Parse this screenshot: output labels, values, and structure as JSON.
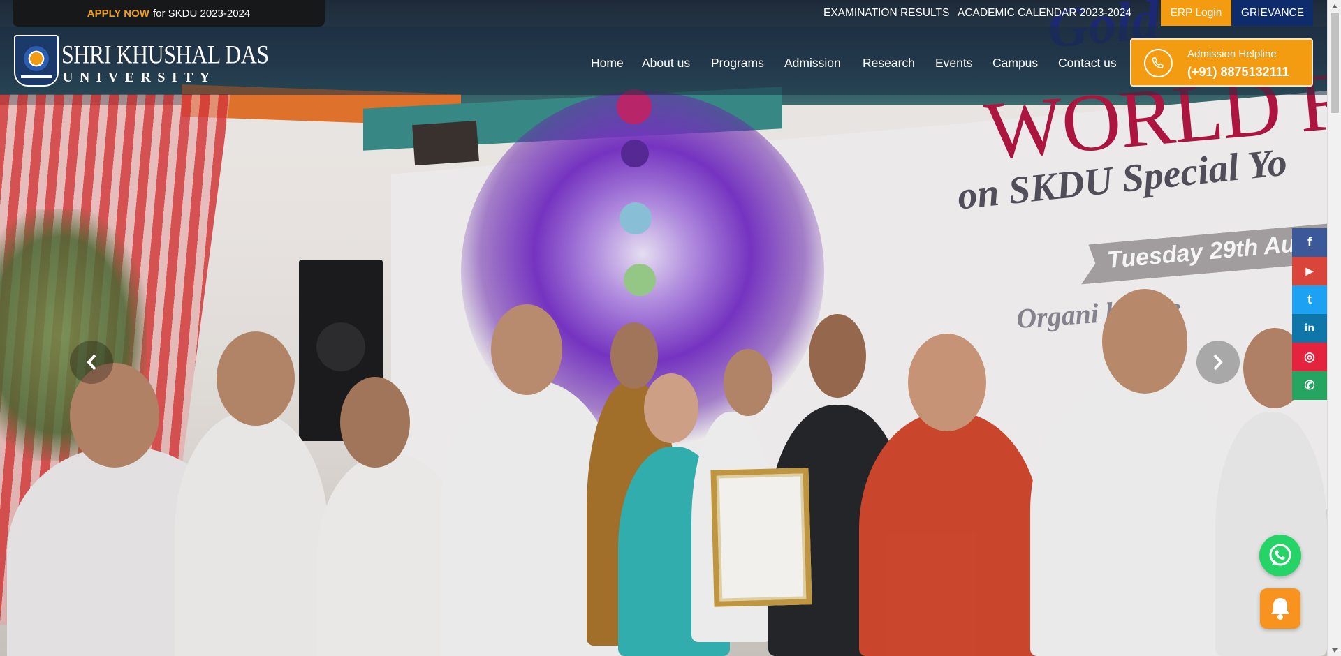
{
  "topbar": {
    "apply_now": "APPLY NOW",
    "apply_rest": "for SKDU 2023-2024",
    "exam_results": "EXAMINATION RESULTS",
    "academic_calendar": "ACADEMIC CALENDAR 2023-2024",
    "erp_login": "ERP Login",
    "grievance": "GRIEVANCE"
  },
  "logo": {
    "line1": "SHRI KHUSHAL DAS",
    "line2": "UNIVERSITY",
    "crest_icon": "university-crest-icon"
  },
  "nav": {
    "items": [
      {
        "label": "Home"
      },
      {
        "label": "About us"
      },
      {
        "label": "Programs"
      },
      {
        "label": "Admission"
      },
      {
        "label": "Research"
      },
      {
        "label": "Events"
      },
      {
        "label": "Campus"
      },
      {
        "label": "Contact us"
      }
    ]
  },
  "helpline": {
    "label": "Admission Helpline",
    "number": "(+91) 8875132111",
    "icon": "phone-icon"
  },
  "hero": {
    "banner_line0": "Gold",
    "banner_line1": "WORLD RE",
    "banner_line2": "on SKDU Special Yo",
    "banner_ribbon": "Tuesday 29th Au",
    "banner_line3": "Organi       by:  De"
  },
  "social": {
    "items": [
      {
        "name": "facebook",
        "glyph": "f",
        "color": "#3b5998"
      },
      {
        "name": "youtube",
        "glyph": "▶",
        "color": "#d9443b"
      },
      {
        "name": "twitter",
        "glyph": "t",
        "color": "#1da1f2"
      },
      {
        "name": "linkedin",
        "glyph": "in",
        "color": "#0e76a8"
      },
      {
        "name": "instagram",
        "glyph": "◎",
        "color": "#e4233e"
      },
      {
        "name": "whatsapp",
        "glyph": "✆",
        "color": "#25a55f"
      }
    ]
  },
  "colors": {
    "accent_orange": "#f39c12",
    "navy": "#0e2b6c",
    "whatsapp_green": "#25d366"
  }
}
